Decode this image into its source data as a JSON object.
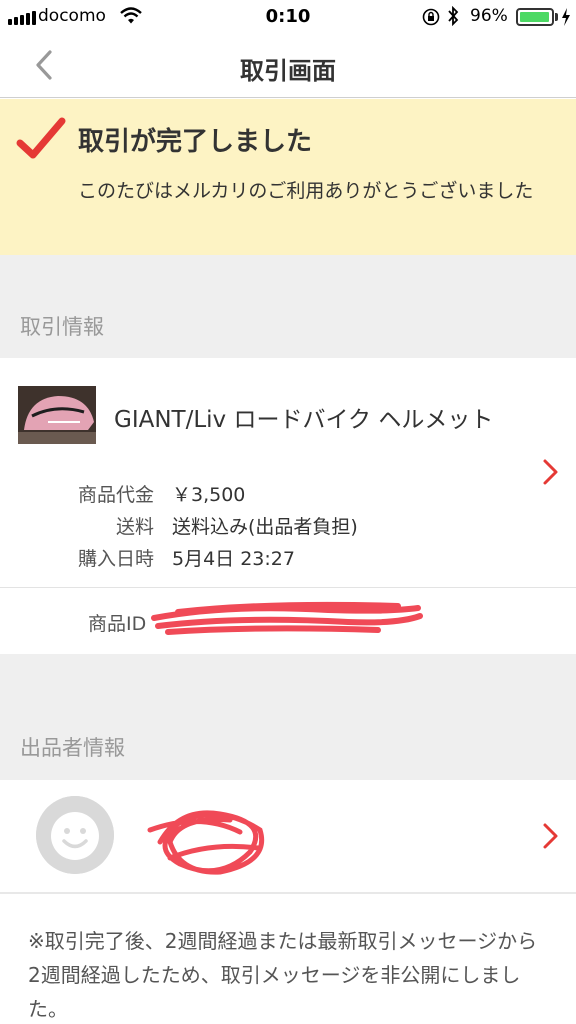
{
  "status_bar": {
    "carrier": "docomo",
    "time": "0:10",
    "battery_percent": "96%",
    "battery_level": 0.96,
    "icons": [
      "signal-icon",
      "wifi-icon",
      "rotation-lock-icon",
      "bluetooth-icon",
      "battery-icon",
      "charging-icon"
    ]
  },
  "nav": {
    "title": "取引画面",
    "back_icon": "chevron-left-icon"
  },
  "banner": {
    "headline": "取引が完了しました",
    "message": "このたびはメルカリのご利用ありがとうございました",
    "icon": "check-icon",
    "background": "#fdf3c4",
    "check_color": "#e53935"
  },
  "transaction": {
    "section_label": "取引情報",
    "item_title": "GIANT/Liv ロードバイク ヘルメット",
    "details": [
      {
        "label": "商品代金",
        "value": "￥3,500"
      },
      {
        "label": "送料",
        "value": "送料込み(出品者負担)"
      },
      {
        "label": "購入日時",
        "value": "5月4日 23:27"
      }
    ],
    "product_id_label": "商品ID"
  },
  "seller": {
    "section_label": "出品者情報",
    "avatar_icon": "default-avatar-icon"
  },
  "notice": "※取引完了後、2週間経過または最新取引メッセージから2週間経過したため、取引メッセージを非公開にしました。",
  "colors": {
    "accent_red": "#e53935",
    "section_gray": "#efefef",
    "label_gray": "#999999"
  }
}
